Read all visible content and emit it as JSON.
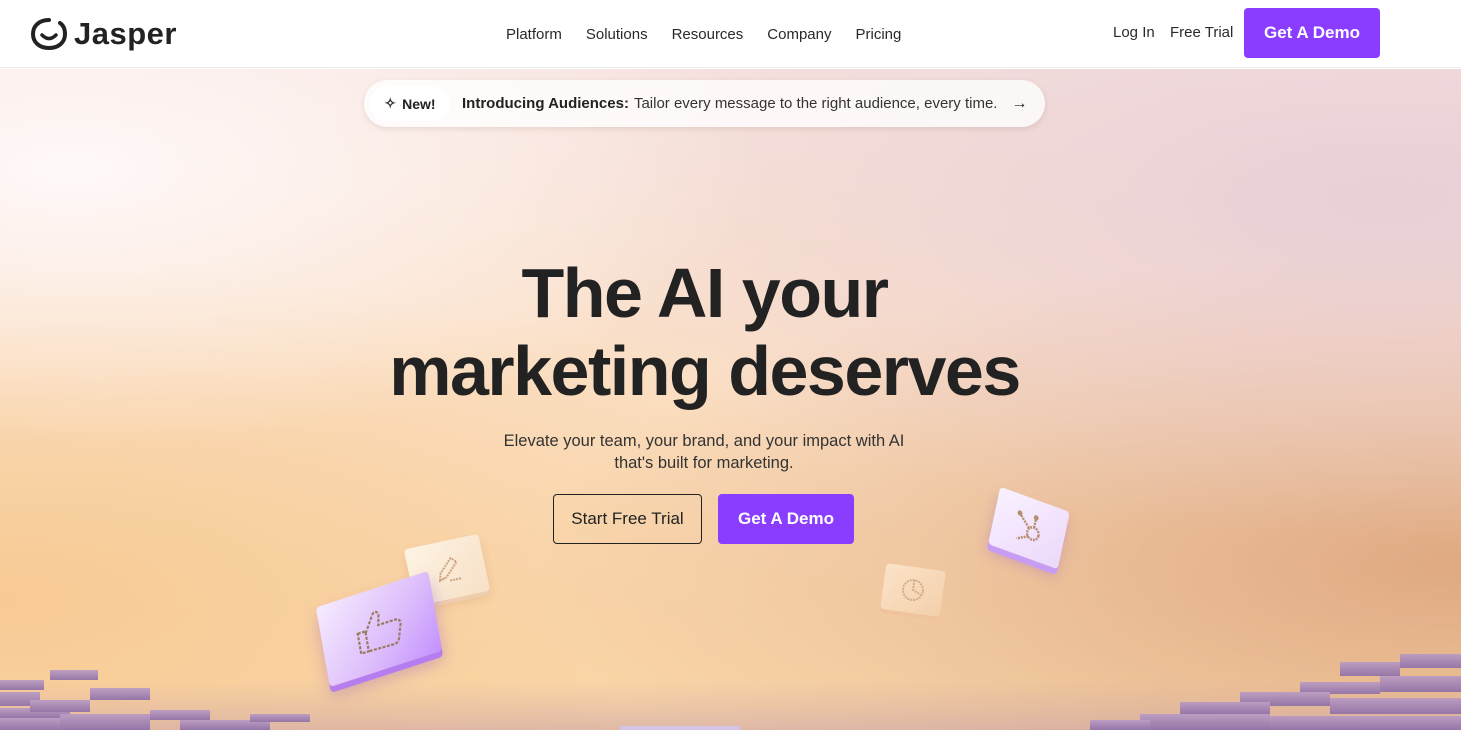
{
  "brand": {
    "name": "Jasper",
    "accent": "#8b3dff"
  },
  "nav": {
    "items": [
      "Platform",
      "Solutions",
      "Resources",
      "Company",
      "Pricing"
    ]
  },
  "header_actions": {
    "login": "Log In",
    "free_trial": "Free Trial",
    "demo": "Get A Demo"
  },
  "announcement": {
    "badge": "New!",
    "title": "Introducing Audiences:",
    "text": "Tailor every message to the right audience, every time.",
    "icon": "arrow-right-icon"
  },
  "hero": {
    "headline_line1": "The AI your",
    "headline_line2": "marketing deserves",
    "subtext_line1": "Elevate your team, your brand, and your impact with AI",
    "subtext_line2": "that's built for marketing.",
    "primary_cta": "Start Free Trial",
    "secondary_cta": "Get A Demo"
  },
  "decorations": {
    "tile_icons": [
      "thumbs-up-icon",
      "pencil-icon",
      "pie-chart-icon",
      "hubspot-icon"
    ]
  }
}
